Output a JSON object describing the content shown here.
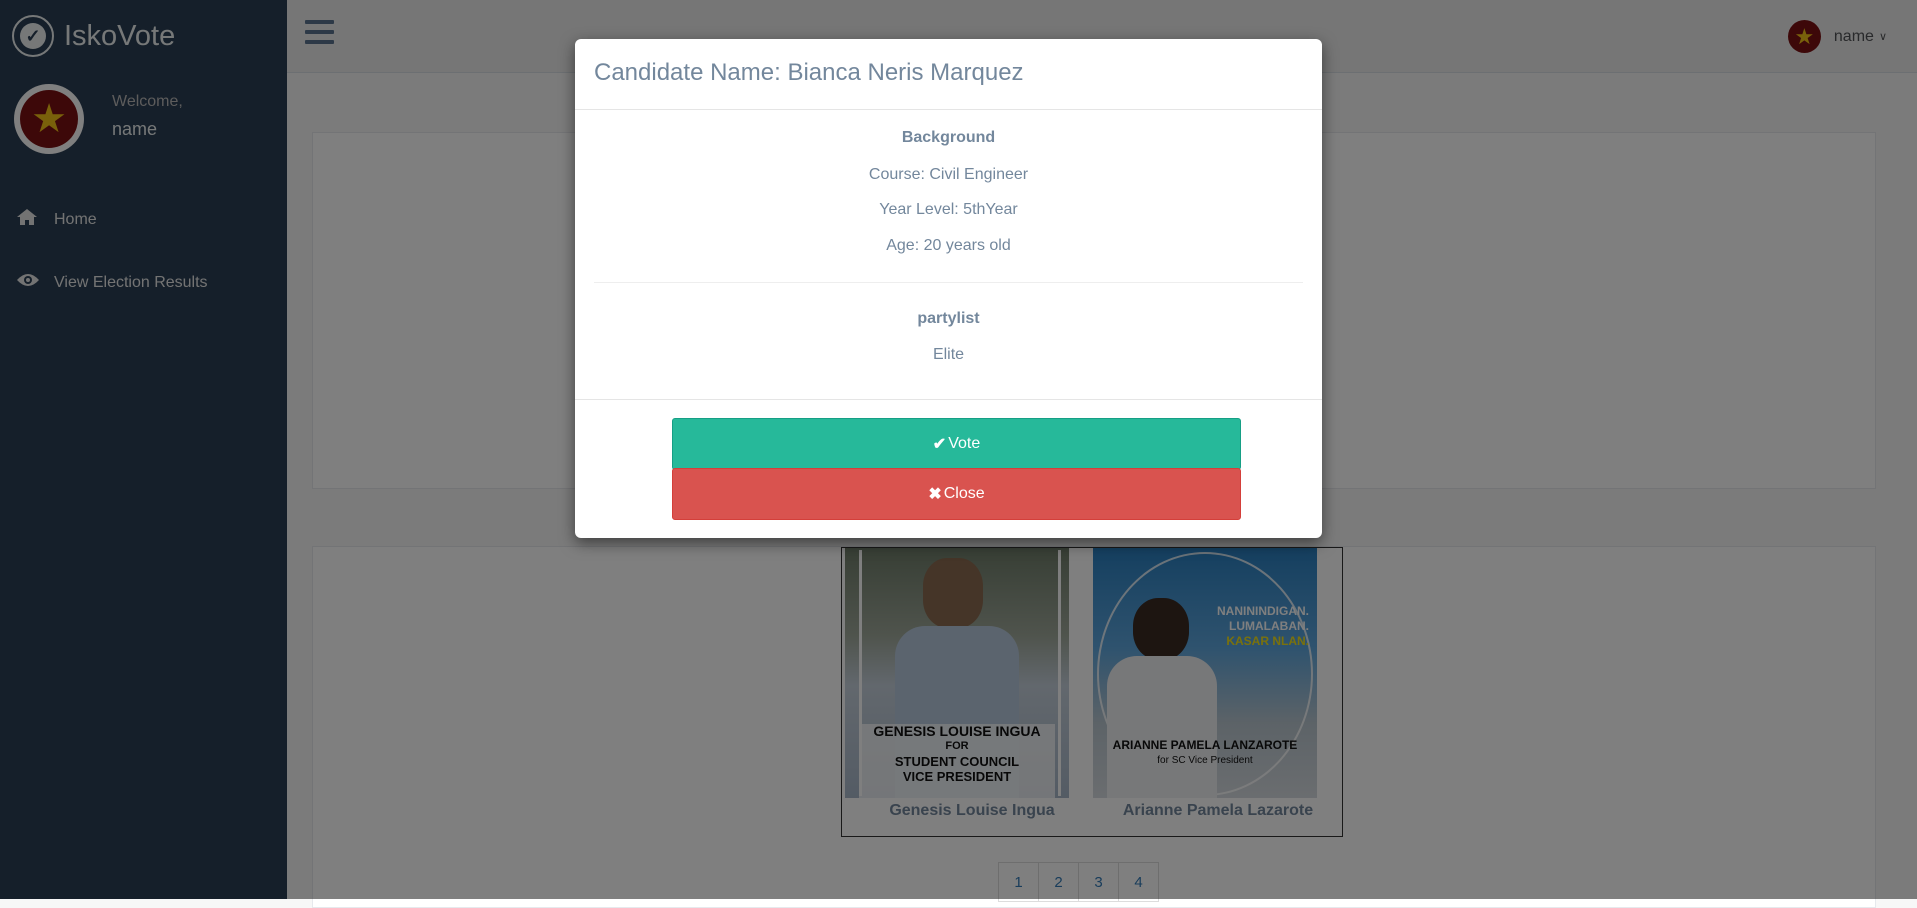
{
  "app": {
    "title": "IskoVote"
  },
  "sidebar": {
    "welcome": "Welcome,",
    "username": "name",
    "items": [
      {
        "label": "Home",
        "icon": "home-icon"
      },
      {
        "label": "View Election Results",
        "icon": "eye-icon"
      }
    ]
  },
  "topbar": {
    "username": "name"
  },
  "candidates": [
    {
      "name": "Genesis Louise Ingua",
      "poster_lines": [
        "GENESIS LOUISE INGUA",
        "FOR",
        "STUDENT COUNCIL",
        "VICE PRESIDENT"
      ]
    },
    {
      "name": "Arianne Pamela Lazarote",
      "poster_lines": [
        "NANININDIGAN.",
        "LUMALABAN.",
        "KASAR NLAN.",
        "ARIANNE PAMELA LANZAROTE",
        "for SC Vice President"
      ]
    }
  ],
  "pagination": [
    "1",
    "2",
    "3",
    "4"
  ],
  "modal": {
    "title": "Candidate Name: Bianca Neris Marquez",
    "background_heading": "Background",
    "course": "Course: Civil Engineer",
    "year_level": "Year Level: 5thYear",
    "age": "Age: 20 years old",
    "partylist_heading": "partylist",
    "partylist": "Elite",
    "vote_label": "Vote",
    "close_label": "Close"
  },
  "colors": {
    "sidebar": "#2a3f54",
    "vote": "#26b99a",
    "close": "#d9534f",
    "maroon": "#7b1113",
    "gold": "#f3c316"
  }
}
